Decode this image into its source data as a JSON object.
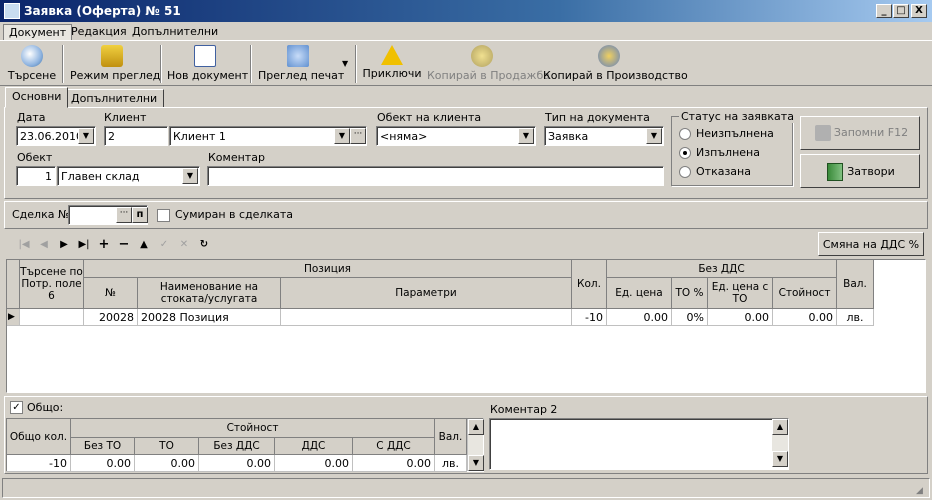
{
  "window": {
    "title": "Заявка (Оферта) № 51",
    "min": "_",
    "max": "□",
    "close": "X"
  },
  "menu": [
    "Документ",
    "Редакция",
    "Допълнителни"
  ],
  "toolbar": {
    "search": "Търсене",
    "view_mode": "Режим преглед",
    "new_doc": "Нов документ",
    "print_preview": "Преглед печат",
    "finish": "Приключи",
    "copy_sale": "Копирай в Продажба",
    "copy_production": "Копирай в Производство"
  },
  "tabs": [
    "Основни",
    "Допълнителни"
  ],
  "form": {
    "date_label": "Дата",
    "date_value": "23.06.2010",
    "client_label": "Клиент",
    "client_code": "2",
    "client_name": "Клиент 1",
    "client_object_label": "Обект на клиента",
    "client_object_value": "<няма>",
    "doc_type_label": "Тип на документа",
    "doc_type_value": "Заявка",
    "status_label": "Статус на заявката",
    "status_options": [
      "Неизпълнена",
      "Изпълнена",
      "Отказана"
    ],
    "status_selected": "Изпълнена",
    "object_label": "Обект",
    "object_code": "1",
    "object_name": "Главен склад",
    "comment_label": "Коментар",
    "comment_value": "",
    "save_button": "Запомни  F12",
    "close_button": "Затвори"
  },
  "deal": {
    "label": "Сделка №",
    "value": "",
    "summed_label": "Сумиран в сделката",
    "summed_checked": false
  },
  "vat_change_button": "Смяна на ДДС %",
  "nav_icons": [
    "first-icon",
    "prev-icon",
    "next-icon",
    "last-icon",
    "add-icon",
    "delete-icon",
    "up-icon",
    "confirm-icon",
    "cancel-icon",
    "refresh-icon"
  ],
  "grid": {
    "headers": {
      "search_by": "Търсене по Потр. поле 6",
      "position_group": "Позиция",
      "no_vat_group": "Без ДДС",
      "no": "№",
      "name": "Наименование на стоката/услугата",
      "params": "Параметри",
      "qty": "Кол.",
      "unit_price": "Ед. цена",
      "to_pct": "ТО %",
      "unit_price_to": "Ед. цена с ТО",
      "value": "Стойност",
      "currency": "Вал."
    },
    "rows": [
      {
        "search": "",
        "no": "20028",
        "name": "20028 Позиция",
        "params": "",
        "qty": "-10",
        "unit_price": "0.00",
        "to_pct": "0%",
        "unit_price_to": "0.00",
        "value": "0.00",
        "currency": "лв."
      }
    ]
  },
  "totals": {
    "label": "Общо:",
    "checked": true,
    "headers": {
      "total_qty": "Общо кол.",
      "value_group": "Стойност",
      "no_to": "Без ТО",
      "to": "ТО",
      "no_vat": "Без ДДС",
      "vat": "ДДС",
      "with_vat": "С ДДС",
      "currency": "Вал."
    },
    "row": {
      "total_qty": "-10",
      "no_to": "0.00",
      "to": "0.00",
      "no_vat": "0.00",
      "vat": "0.00",
      "with_vat": "0.00",
      "currency": "лв."
    }
  },
  "comment2": {
    "label": "Коментар 2",
    "value": ""
  }
}
